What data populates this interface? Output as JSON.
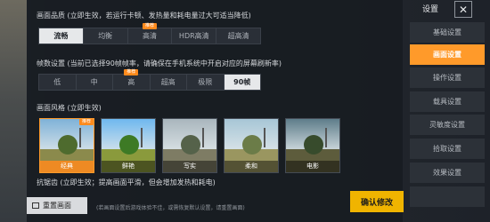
{
  "quality": {
    "title": "画面品质 (立即生效，若运行卡顿、发热量和耗电量过大可适当降低)",
    "options": [
      {
        "label": "流畅",
        "active": true,
        "badge": ""
      },
      {
        "label": "均衡",
        "active": false,
        "badge": ""
      },
      {
        "label": "高清",
        "active": false,
        "badge": "推荐"
      },
      {
        "label": "HDR高清",
        "active": false,
        "badge": ""
      },
      {
        "label": "超高清",
        "active": false,
        "badge": ""
      }
    ]
  },
  "framerate": {
    "title": "帧数设置 (当前已选择90帧帧率，请确保在手机系统中开启对应的屏幕刷新率)",
    "options": [
      {
        "label": "低",
        "active": false,
        "badge": ""
      },
      {
        "label": "中",
        "active": false,
        "badge": ""
      },
      {
        "label": "高",
        "active": false,
        "badge": "推荐"
      },
      {
        "label": "超高",
        "active": false,
        "badge": ""
      },
      {
        "label": "极限",
        "active": false,
        "badge": ""
      },
      {
        "label": "90帧",
        "active": true,
        "badge": ""
      }
    ]
  },
  "style": {
    "title": "画面风格 (立即生效)",
    "cards": [
      {
        "label": "经典",
        "active": true,
        "badge": "推荐",
        "sky": "#7fb2d8",
        "ground": "#8b8a4c",
        "tree": "#4e6b2e"
      },
      {
        "label": "鲜艳",
        "active": false,
        "badge": "",
        "sky": "#6fb8ef",
        "ground": "#8a9a3c",
        "tree": "#3d7a25"
      },
      {
        "label": "写实",
        "active": false,
        "badge": "",
        "sky": "#a9b6bd",
        "ground": "#7e7c64",
        "tree": "#55624a"
      },
      {
        "label": "柔和",
        "active": false,
        "badge": "",
        "sky": "#a7c6d6",
        "ground": "#9a9660",
        "tree": "#6b7c48"
      },
      {
        "label": "电影",
        "active": false,
        "badge": "",
        "sky": "#5e7d8a",
        "ground": "#5d5c3c",
        "tree": "#374b2c"
      }
    ]
  },
  "antialias": {
    "title": "抗锯齿 (立即生效；提高画面平滑，但会增加发热和耗电)"
  },
  "footer": {
    "reset_label": "重置画面",
    "note": "(若画面设置后游戏体验不佳，或需恢复默认设置，请重置画面)",
    "confirm_label": "确认修改"
  },
  "sidebar": {
    "title": "设置",
    "close_icon": "✕",
    "items": [
      {
        "label": "基础设置",
        "active": false
      },
      {
        "label": "画面设置",
        "active": true
      },
      {
        "label": "操作设置",
        "active": false
      },
      {
        "label": "载具设置",
        "active": false
      },
      {
        "label": "灵敏度设置",
        "active": false
      },
      {
        "label": "拾取设置",
        "active": false
      },
      {
        "label": "效果设置",
        "active": false
      },
      {
        "label": "",
        "active": false
      }
    ]
  },
  "colors": {
    "accent": "#ff9a2a",
    "confirm": "#f0b400",
    "badge": "#ff8a1c"
  }
}
